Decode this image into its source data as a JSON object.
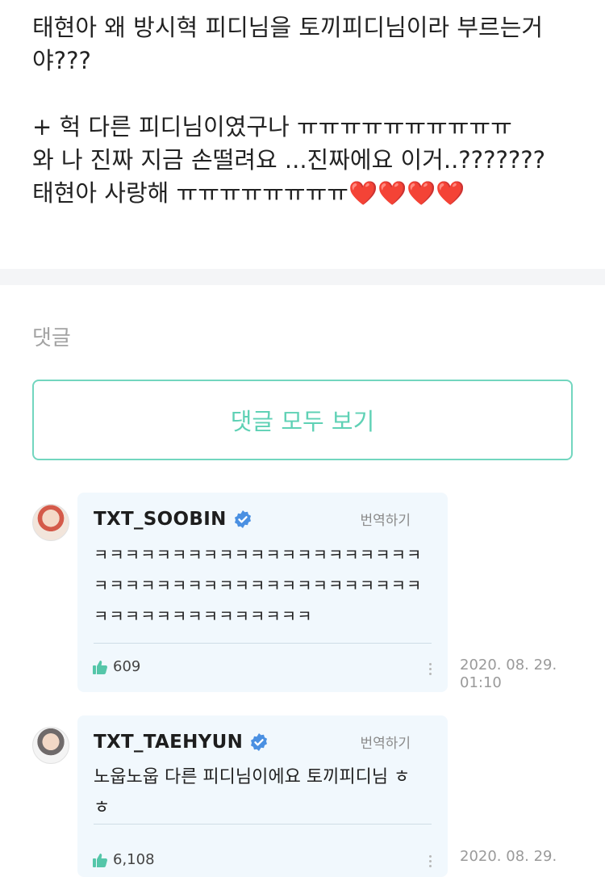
{
  "post": {
    "lines": [
      "태현아 왜 방시혁 피디님을 토끼피디님이라 부르는거",
      "야???",
      "",
      "+ 헉 다른 피디님이였구나 ㅠㅠㅠㅠㅠㅠㅠㅠㅠㅠ",
      "와 나 진짜 지금 손떨려요 ...진짜에요 이거..???????",
      "태현아 사랑해 ㅠㅠㅠㅠㅠㅠㅠㅠ"
    ],
    "hearts": "❤️❤️❤️❤️"
  },
  "comments_section": {
    "title": "댓글",
    "view_all_label": "댓글 모두 보기"
  },
  "comments": [
    {
      "username": "TXT_SOOBIN",
      "translate_label": "번역하기",
      "text": "ㅋㅋㅋㅋㅋㅋㅋㅋㅋㅋㅋㅋㅋㅋㅋㅋㅋㅋㅋㅋㅋㅋㅋㅋㅋㅋㅋㅋㅋㅋㅋㅋㅋㅋㅋㅋㅋㅋㅋㅋㅋㅋㅋㅋㅋㅋㅋㅋㅋㅋㅋㅋㅋㅋㅋㅋ",
      "likes": "609",
      "date_line1": "2020. 08. 29.",
      "date_line2": "01:10"
    },
    {
      "username": "TXT_TAEHYUN",
      "translate_label": "번역하기",
      "text": "노웁노웁 다른 피디님이에요 토끼피디님 ㅎㅎ",
      "likes": "6,108",
      "date_line1": "2020. 08. 29.",
      "date_line2": ""
    }
  ],
  "colors": {
    "accent": "#5fd1b5",
    "verified": "#4a90e2",
    "like": "#55c6a9",
    "bubble": "#f1f8fd"
  }
}
